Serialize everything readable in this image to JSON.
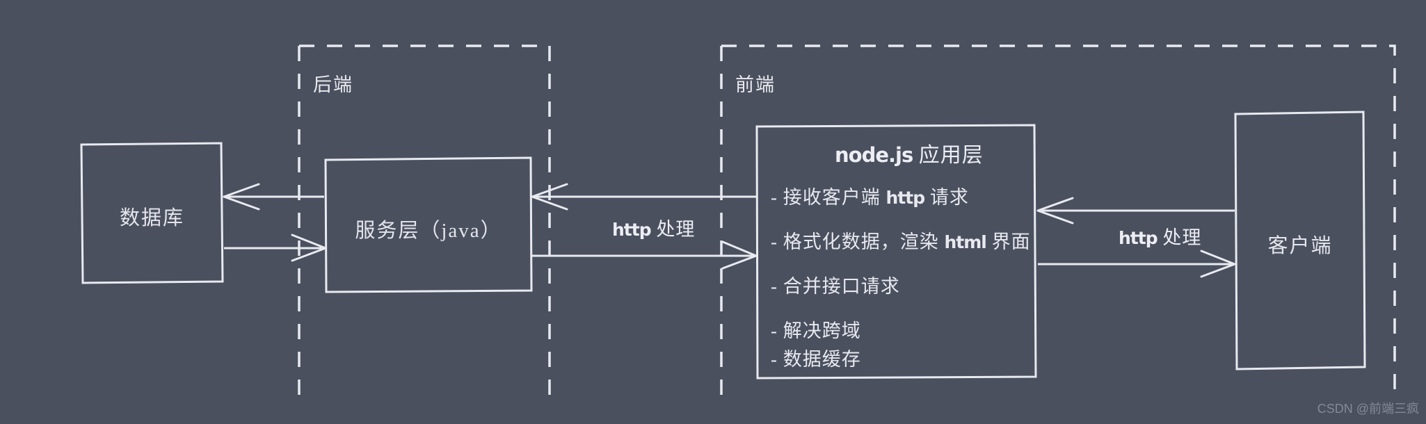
{
  "diagram": {
    "background_color": "#4b505f",
    "stroke_color": "#e8eaf0",
    "zones": [
      {
        "id": "backend",
        "label": "后端"
      },
      {
        "id": "frontend",
        "label": "前端"
      }
    ],
    "boxes": [
      {
        "id": "database",
        "label": "数据库"
      },
      {
        "id": "service",
        "label": "服务层（java）"
      },
      {
        "id": "client",
        "label": "客户端"
      }
    ],
    "node_panel": {
      "title_prefix": "node.js",
      "title_suffix": "应用层",
      "bullets": [
        {
          "dash": "-",
          "text_a": "接收客户端",
          "code": "http",
          "text_b": "请求"
        },
        {
          "dash": "-",
          "text_a": "格式化数据，渲染",
          "code": "html",
          "text_b": "界面"
        },
        {
          "dash": "-",
          "text_a": "合并接口请求",
          "code": "",
          "text_b": ""
        },
        {
          "dash": "-",
          "text_a": "解决跨域",
          "code": "",
          "text_b": ""
        },
        {
          "dash": "-",
          "text_a": "数据缓存",
          "code": "",
          "text_b": ""
        }
      ]
    },
    "edge_labels": [
      {
        "id": "service-to-node",
        "code": "http",
        "text": "处理"
      },
      {
        "id": "node-to-client",
        "code": "http",
        "text": "处理"
      }
    ],
    "watermark": "CSDN @前端三疯"
  }
}
